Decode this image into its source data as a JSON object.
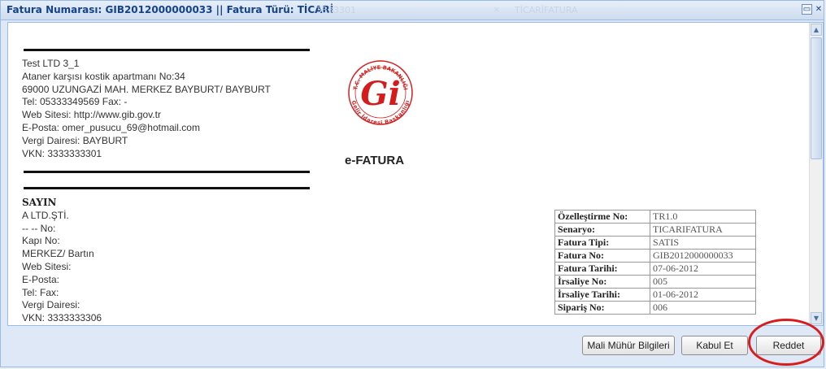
{
  "window": {
    "title": "Fatura Numarası: GIB2012000000033 || Fatura Türü: TİCARİ",
    "ghost_left": "3333301",
    "ghost_right": "TİCARİFATURA"
  },
  "seller": {
    "lines": [
      "Test LTD 3_1",
      "Ataner karşısı kostik apartmanı No:34",
      "69000 UZUNGAZİ MAH. MERKEZ BAYBURT/ BAYBURT",
      "Tel: 05333349569 Fax: -",
      "Web Sitesi: http://www.gib.gov.tr",
      "E-Posta: omer_pusucu_69@hotmail.com",
      "Vergi Dairesi: BAYBURT",
      "VKN: 3333333301"
    ]
  },
  "logo": {
    "top_text": "T.C. MALİYE BAKANLIĞI",
    "bottom_text": "Gelir İdaresi Başkanlığı",
    "mark_letter": "Gi",
    "caption": "e-FATURA",
    "accent_color": "#d41c1c"
  },
  "buyer": {
    "heading": "SAYIN",
    "lines": [
      "A LTD.ŞTİ.",
      "-- -- No:",
      "Kapı No:",
      "MERKEZ/ Bartın",
      "Web Sitesi:",
      "E-Posta:",
      "Tel: Fax:",
      "Vergi Dairesi:",
      "VKN: 3333333306"
    ]
  },
  "details": [
    {
      "key": "Özelleştirme No:",
      "value": "TR1.0"
    },
    {
      "key": "Senaryo:",
      "value": "TICARIFATURA"
    },
    {
      "key": "Fatura Tipi:",
      "value": "SATIS"
    },
    {
      "key": "Fatura No:",
      "value": "GIB2012000000033"
    },
    {
      "key": "Fatura Tarihi:",
      "value": "07-06-2012"
    },
    {
      "key": "İrsaliye No:",
      "value": "005"
    },
    {
      "key": "İrsaliye Tarihi:",
      "value": "01-06-2012"
    },
    {
      "key": "Sipariş No:",
      "value": "006"
    }
  ],
  "buttons": {
    "seal_info": "Mali Mühür Bilgileri",
    "accept": "Kabul Et",
    "reject": "Reddet"
  },
  "colors": {
    "highlight_circle": "#d71e1e",
    "title_text": "#15428b"
  }
}
